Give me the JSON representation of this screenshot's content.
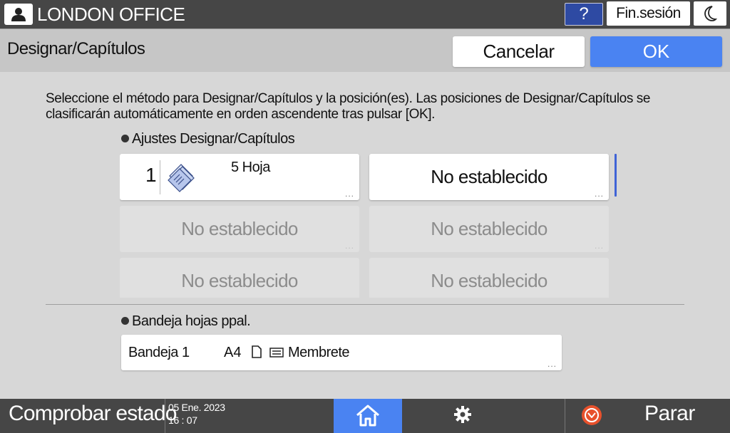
{
  "topbar": {
    "user_icon": "user-icon",
    "office_name": "LONDON OFFICE",
    "help_label": "?",
    "logout_label": "Fin.sesión",
    "moon_icon": "moon-icon"
  },
  "header": {
    "title": "Designar/Capítulos",
    "cancel_label": "Cancelar",
    "ok_label": "OK"
  },
  "instruction": "Seleccione el método para Designar/Capítulos y la posición(es). Las posiciones de Designar/Capítulos se clasificarán automáticamente en orden ascendente tras pulsar [OK].",
  "settings_section": {
    "label": "Ajustes Designar/Capítulos",
    "slots": [
      {
        "number": "1",
        "sheets": "5 Hoja",
        "more": "..."
      },
      {
        "text": "No establecido",
        "more": "..."
      },
      {
        "text": "No establecido",
        "more": "..."
      },
      {
        "text": "No establecido",
        "more": "..."
      },
      {
        "text": "No establecido",
        "more": "..."
      },
      {
        "text": "No establecido",
        "more": "..."
      }
    ]
  },
  "tray_section": {
    "label": "Bandeja hojas ppal.",
    "tray_name": "Bandeja 1",
    "paper_size": "A4",
    "paper_type": "Membrete",
    "more": "..."
  },
  "bottombar": {
    "status_label": "Comprobar estado",
    "date": "05 Ene. 2023",
    "time": "16 : 07",
    "stop_label": "Parar"
  },
  "colors": {
    "accent_blue": "#4a83f2",
    "help_blue": "#2e4aa3",
    "bar_dark": "#464646",
    "stop_orange": "#e8512c"
  }
}
